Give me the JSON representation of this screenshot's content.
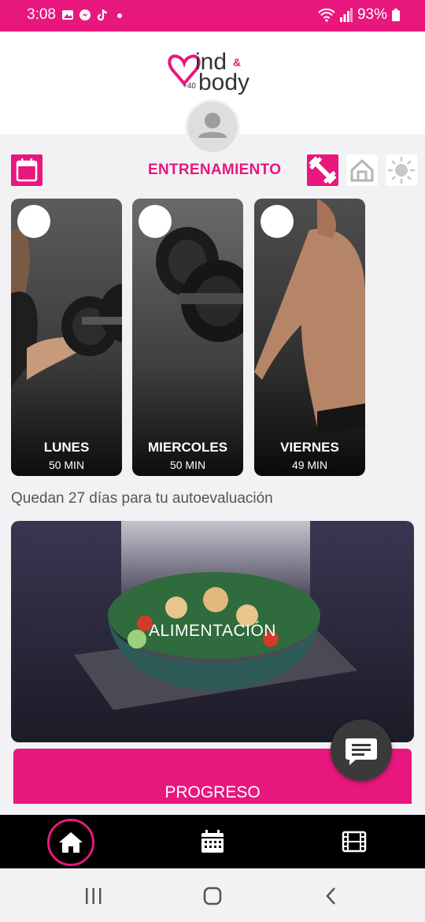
{
  "status_bar": {
    "time": "3:08",
    "battery": "93%",
    "icons": [
      "image-icon",
      "messenger-icon",
      "tiktok-icon",
      "dot-icon",
      "wifi-icon",
      "signal-icon",
      "battery-icon"
    ]
  },
  "app": {
    "logo_text": "mind & body",
    "logo_badge": "+40"
  },
  "training": {
    "title": "ENTRENAMIENTO",
    "modes": [
      "gym-dumbbell-icon",
      "home-icon",
      "sun-icon"
    ],
    "cards": [
      {
        "day": "LUNES",
        "duration": "50 MIN"
      },
      {
        "day": "MIERCOLES",
        "duration": "50 MIN"
      },
      {
        "day": "VIERNES",
        "duration": "49 MIN"
      }
    ]
  },
  "remaining_text": "Quedan 27 días para tu autoevaluación",
  "nutrition": {
    "label": "ALIMENTACIÓN"
  },
  "progress": {
    "label": "PROGRESO"
  },
  "bottom_nav": [
    "home-icon",
    "calendar-icon",
    "film-icon"
  ],
  "colors": {
    "accent": "#e8177e",
    "nav_bg": "#000000"
  }
}
